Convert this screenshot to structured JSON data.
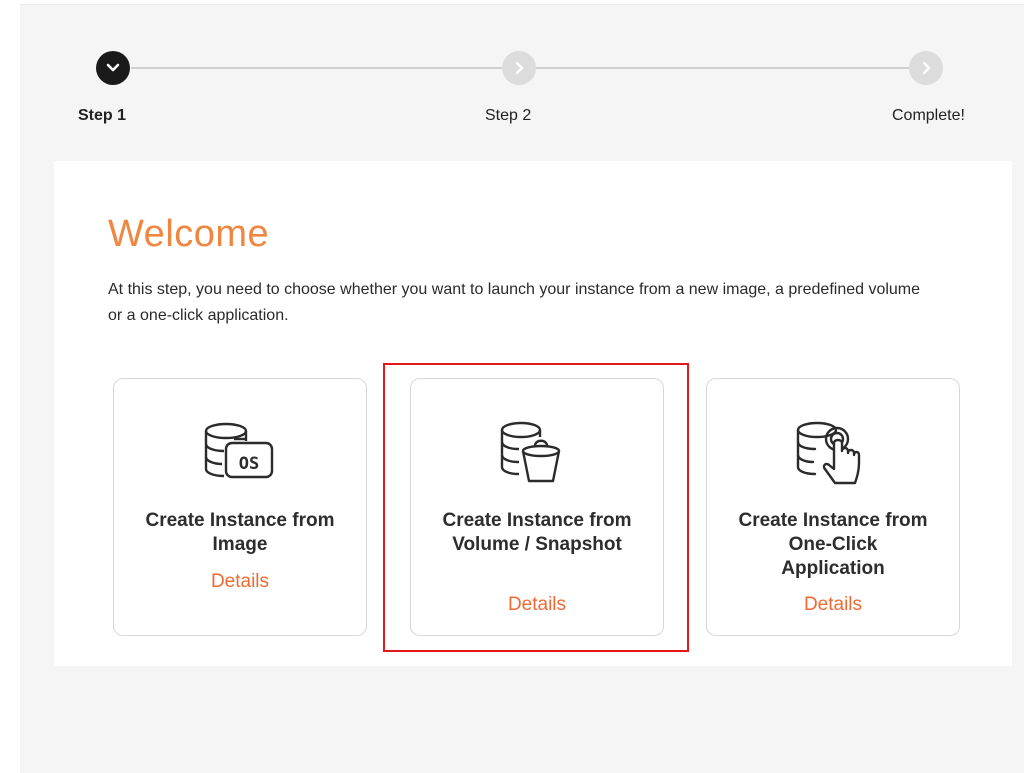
{
  "stepper": {
    "steps": [
      {
        "label": "Step 1",
        "state": "active"
      },
      {
        "label": "Step 2",
        "state": "inactive"
      },
      {
        "label": "Complete!",
        "state": "inactive"
      }
    ]
  },
  "welcome": {
    "heading": "Welcome",
    "description": "At this step, you need to choose whether you want to launch your instance from a new image, a predefined volume or a one-click application."
  },
  "cards": [
    {
      "title": "Create Instance from Image",
      "details": "Details",
      "icon": "database-os-icon"
    },
    {
      "title": "Create Instance from Volume / Snapshot",
      "details": "Details",
      "icon": "database-bucket-icon"
    },
    {
      "title": "Create Instance from One-Click Application",
      "details": "Details",
      "icon": "database-touch-icon"
    }
  ],
  "colors": {
    "accent": "#f0863f",
    "link": "#ef6a32",
    "highlight": "#e3181f"
  }
}
